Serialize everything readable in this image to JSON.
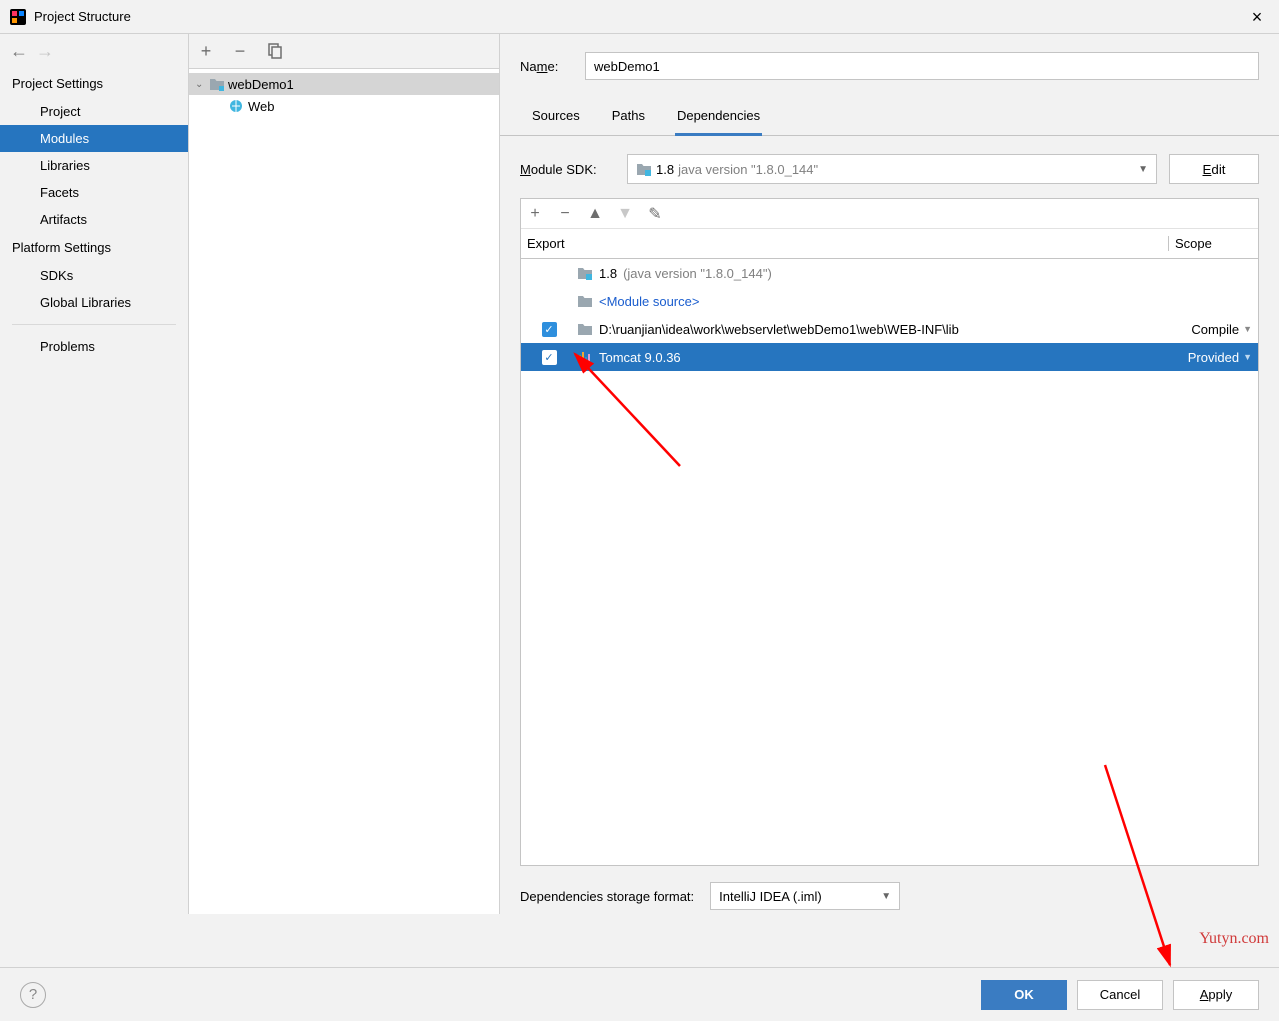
{
  "window": {
    "title": "Project Structure"
  },
  "sidebar": {
    "categories": [
      {
        "label": "Project Settings",
        "items": [
          "Project",
          "Modules",
          "Libraries",
          "Facets",
          "Artifacts"
        ]
      },
      {
        "label": "Platform Settings",
        "items": [
          "SDKs",
          "Global Libraries"
        ]
      }
    ],
    "selected": "Modules",
    "problems": "Problems"
  },
  "tree": {
    "root": "webDemo1",
    "child": "Web"
  },
  "right": {
    "name_label": "Name:",
    "name_value": "webDemo1",
    "tabs": [
      "Sources",
      "Paths",
      "Dependencies"
    ],
    "active_tab": "Dependencies",
    "sdk_label": "Module SDK:",
    "sdk_value": "1.8",
    "sdk_version": "java version \"1.8.0_144\"",
    "edit_label": "Edit",
    "columns": {
      "export": "Export",
      "scope": "Scope"
    },
    "rows": [
      {
        "name": "1.8",
        "suffix": "(java version \"1.8.0_144\")",
        "icon": "sdk",
        "check": false,
        "scope": ""
      },
      {
        "name": "<Module source>",
        "icon": "module",
        "check": false,
        "scope": "",
        "link": true
      },
      {
        "name": "D:\\ruanjian\\idea\\work\\webservlet\\webDemo1\\web\\WEB-INF\\lib",
        "icon": "folder",
        "check": true,
        "scope": "Compile"
      },
      {
        "name": "Tomcat 9.0.36",
        "icon": "library",
        "check": true,
        "scope": "Provided",
        "selected": true
      }
    ],
    "storage_label": "Dependencies storage format:",
    "storage_value": "IntelliJ IDEA (.iml)"
  },
  "buttons": {
    "ok": "OK",
    "cancel": "Cancel",
    "apply": "Apply"
  },
  "watermark": "Yutyn.com"
}
